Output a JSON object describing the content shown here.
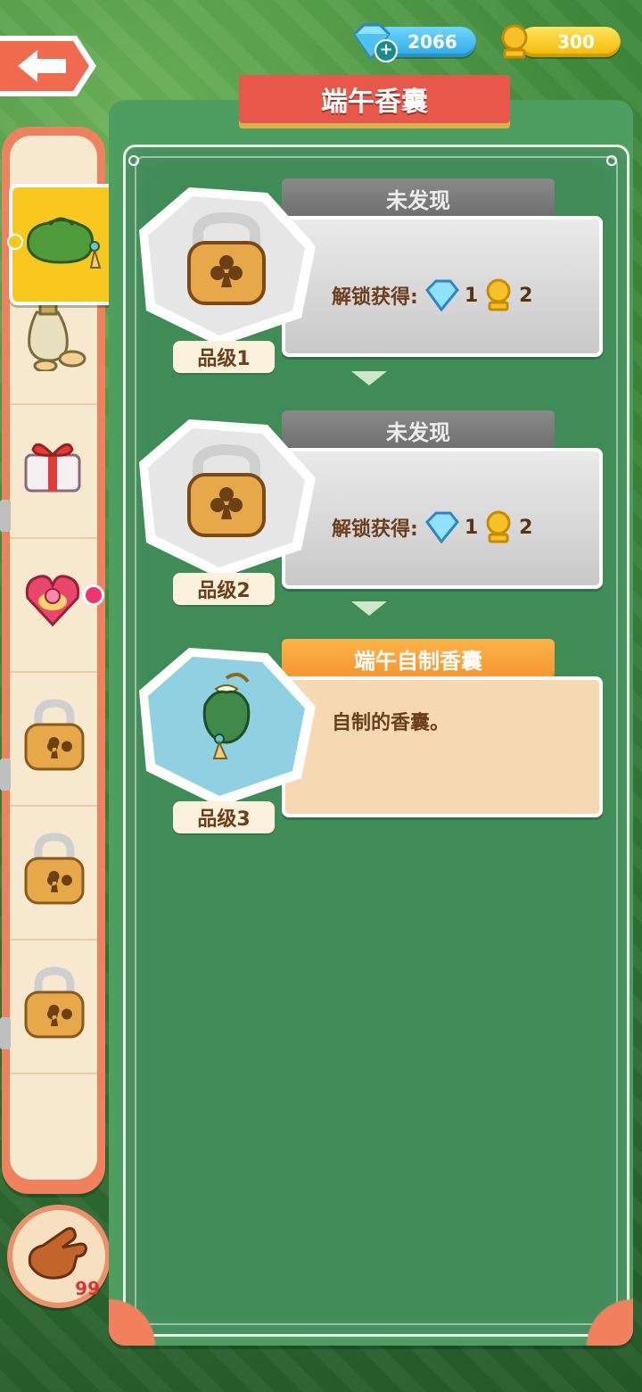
{
  "currency": {
    "gems": "2066",
    "gold": "300"
  },
  "title": "端午香囊",
  "cards": [
    {
      "status": "locked",
      "header": "未发现",
      "reward_label": "解锁获得:",
      "reward_gem": "1",
      "reward_gold": "2",
      "grade": "品级1"
    },
    {
      "status": "locked",
      "header": "未发现",
      "reward_label": "解锁获得:",
      "reward_gem": "1",
      "reward_gold": "2",
      "grade": "品级2"
    },
    {
      "status": "unlocked",
      "header": "端午自制香囊",
      "description": "自制的香囊。",
      "grade": "品级3"
    }
  ],
  "sidebar": {
    "items": [
      {
        "icon": "sachet-icon",
        "selected": true
      },
      {
        "icon": "wine-jar-icon"
      },
      {
        "icon": "gift-box-icon"
      },
      {
        "icon": "ring-box-icon",
        "badge": true
      },
      {
        "icon": "lock-icon"
      },
      {
        "icon": "lock-icon"
      },
      {
        "icon": "lock-icon"
      }
    ]
  },
  "hand": {
    "count": "99"
  },
  "colors": {
    "panel": "#4e9e62",
    "title_banner": "#e8584a",
    "sidebar_border": "#f0815e",
    "locked_header": "#7a7a7a",
    "unlocked_header": "#f5942e"
  }
}
